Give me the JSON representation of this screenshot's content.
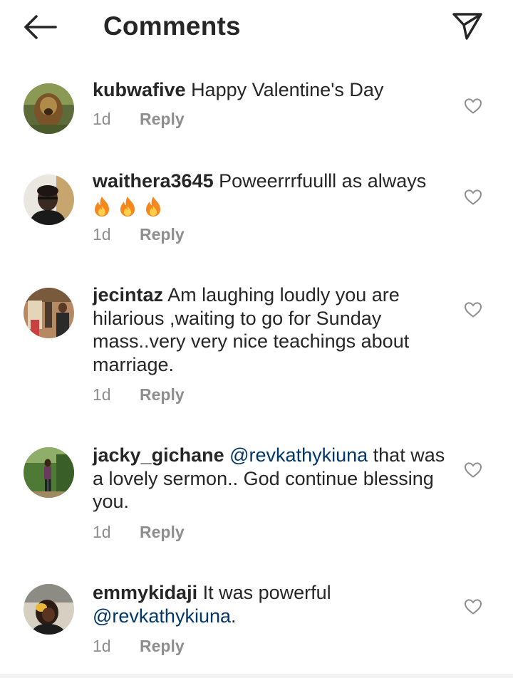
{
  "header": {
    "title": "Comments",
    "back_icon": "arrow-left-icon",
    "share_icon": "paper-plane-icon"
  },
  "colors": {
    "text": "#262626",
    "muted": "#8e8e8e",
    "mention": "#00376b",
    "fire": "#f5871f"
  },
  "comments": [
    {
      "username": "kubwafive",
      "text": "Happy Valentine's Day",
      "time": "1d",
      "reply_label": "Reply"
    },
    {
      "username": "waithera3645",
      "text": "Poweerrrfuulll as always",
      "emoji": "🔥🔥🔥",
      "time": "1d",
      "reply_label": "Reply"
    },
    {
      "username": "jecintaz",
      "text": "Am laughing loudly you are hilarious ,waiting to go for Sunday mass..very very nice teachings about marriage.",
      "time": "1d",
      "reply_label": "Reply"
    },
    {
      "username": "jacky_gichane",
      "mention": "@revkathykiuna",
      "text": "that was a lovely sermon.. God continue blessing you.",
      "time": "1d",
      "reply_label": "Reply"
    },
    {
      "username": "emmykidaji",
      "text": "It was powerful",
      "mention": "@revkathykiuna",
      "text_after": ".",
      "time": "1d",
      "reply_label": "Reply"
    }
  ]
}
